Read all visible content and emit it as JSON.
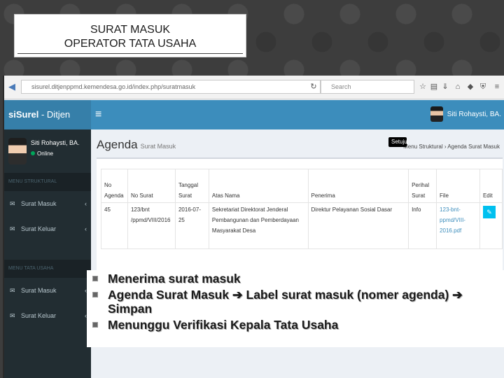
{
  "slide": {
    "title_line1": "SURAT MASUK",
    "title_line2": "OPERATOR TATA USAHA"
  },
  "browser": {
    "url": "sisurel.ditjenppmd.kemendesa.go.id/index.php/suratmasuk",
    "search_placeholder": "Search"
  },
  "app": {
    "brand_bold": "siSurel",
    "brand_rest": " - Ditjen PPMD",
    "hamburger": "≡",
    "header_user": "Siti Rohaysti, BA."
  },
  "sidebar": {
    "user_name": "Siti Rohaysti, BA.",
    "user_status": "Online",
    "header1": "MENU STRUKTURAL",
    "header2": "MENU TATA USAHA",
    "items1": [
      {
        "label": "Surat Masuk",
        "icon": "✉",
        "caret": "‹"
      },
      {
        "label": "Surat Keluar",
        "icon": "✉",
        "caret": "‹"
      }
    ],
    "items2": [
      {
        "label": "Surat Masuk",
        "icon": "✉",
        "caret": "‹"
      },
      {
        "label": "Surat Keluar",
        "icon": "✉",
        "caret": "‹"
      }
    ]
  },
  "content": {
    "title": "Agenda",
    "subtitle": "Surat Masuk",
    "breadcrumb": "Menu Struktural  ›  Agenda Surat Masuk",
    "table": {
      "headers": [
        "No Agenda",
        "No Surat",
        "Tanggal Surat",
        "Atas Nama",
        "Penerima",
        "Perihal Surat",
        "File",
        "Edit"
      ],
      "rows": [
        [
          "45",
          "123/bnt /ppmd/VIII/2016",
          "2016-07-25",
          "Sekretariat Direktorat Jenderal Pembangunan dan Pemberdayaan Masyarakat Desa",
          "Direktur Pelayanan Sosial Dasar",
          "Info",
          "123-bnt-ppmd/VIII-2016.pdf",
          ""
        ]
      ]
    },
    "tooltip": "Setujui",
    "edit_icon": "✎"
  },
  "bullets": [
    {
      "parts": [
        "Menerima surat masuk"
      ]
    },
    {
      "parts": [
        "Agenda Surat Masuk ",
        "➔",
        " Label surat masuk (nomer agenda) ",
        "➔",
        " Simpan"
      ]
    },
    {
      "parts": [
        "Menunggu Verifikasi Kepala Tata Usaha"
      ]
    }
  ]
}
